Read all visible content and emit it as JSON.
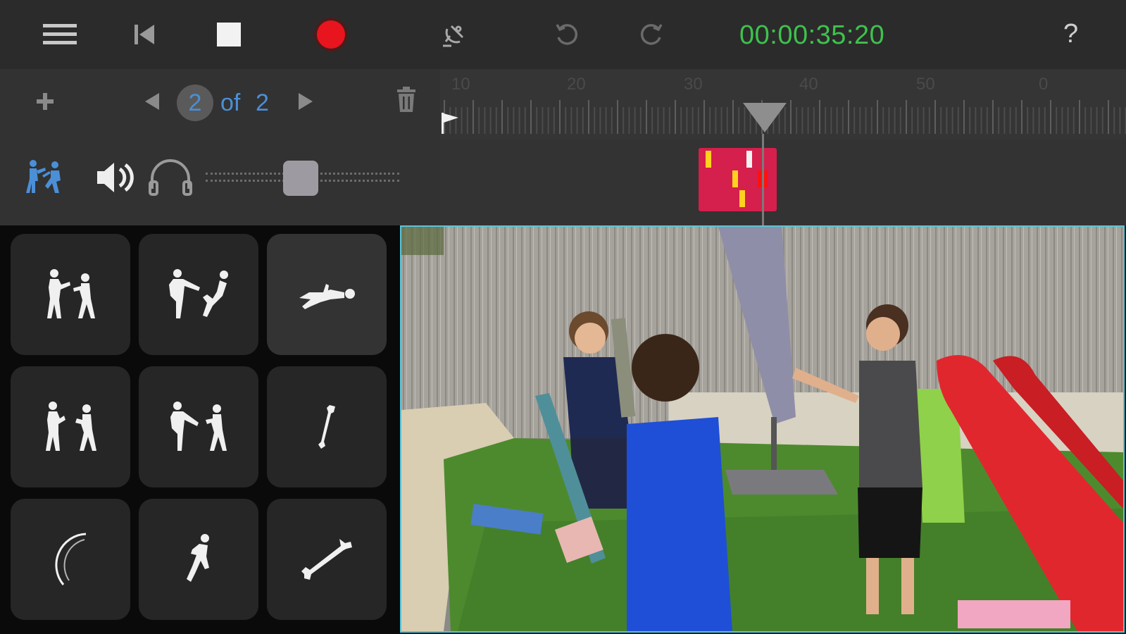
{
  "toolbar": {
    "icons": [
      "menu-icon",
      "skip-back-icon",
      "stop-icon",
      "record-icon",
      "satellite-icon",
      "undo-icon",
      "redo-icon"
    ],
    "timecode": "00:00:35:20",
    "help_label": "?",
    "colors": {
      "timecode": "#3ec24d",
      "record": "#e8141e"
    }
  },
  "pager": {
    "current": "2",
    "of_label": "of",
    "total": "2",
    "icons": [
      "add-icon",
      "prev-icon",
      "next-icon",
      "trash-icon"
    ],
    "accent": "#4b8fd6"
  },
  "audio": {
    "icons": [
      "fight-mode-icon",
      "speaker-icon",
      "headphones-icon"
    ],
    "volume_fraction": 0.4
  },
  "timeline": {
    "ruler_labels": [
      "10",
      "20",
      "30",
      "40",
      "50",
      "0"
    ],
    "clip_color": "#d51f4c"
  },
  "effects": [
    {
      "icon": "punch-fight-icon"
    },
    {
      "icon": "kick-fight-icon"
    },
    {
      "icon": "knockdown-icon",
      "selected": true
    },
    {
      "icon": "boxing-pair-icon"
    },
    {
      "icon": "kick-pair-icon"
    },
    {
      "icon": "bone-small-icon"
    },
    {
      "icon": "swoosh-icon"
    },
    {
      "icon": "falling-man-icon"
    },
    {
      "icon": "bone-large-icon"
    }
  ],
  "preview": {
    "border_color": "#58c3d6"
  }
}
